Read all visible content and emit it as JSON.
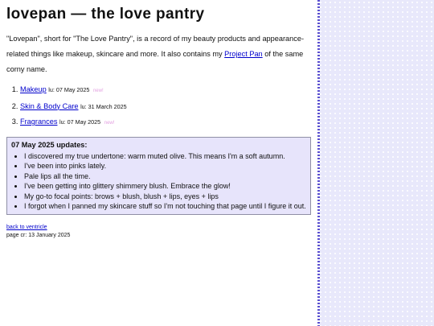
{
  "title": "lovepan — the love pantry",
  "intro": {
    "before_link": "\"Lovepan\", short for \"The Love Pantry\", is a record of my beauty products and appearance-related things like makeup, skincare and more. It also contains my ",
    "link": "Project Pan",
    "after_link": " of the same corny name."
  },
  "nav": [
    {
      "label": "Makeup",
      "lu": "lu: 07 May 2025",
      "badge": "new!"
    },
    {
      "label": "Skin & Body Care",
      "lu": "lu: 31 March 2025",
      "badge": ""
    },
    {
      "label": "Fragrances",
      "lu": "lu: 07 May 2025",
      "badge": "new!"
    }
  ],
  "updates": {
    "heading": "07 May 2025 updates:",
    "items": [
      "I discovered my true undertone: warm muted olive. This means I'm a soft autumn.",
      "I've been into pinks lately.",
      "Pale lips all the time.",
      "I've been getting into glittery shimmery blush. Embrace the glow!",
      "My go-to focal points: brows + blush, blush + lips, eyes + lips",
      "I forgot when I panned my skincare stuff so I'm not touching that page until I figure it out."
    ]
  },
  "footer": {
    "back_link": "back to ventricle",
    "created": "page cr: 13 January 2025"
  },
  "colors": {
    "link": "#0000cc",
    "new_badge": "#e3a0e0",
    "updates_bg": "#e7e4fb",
    "edge": "#5a4fd0",
    "pattern_bg": "#e8e8fb"
  }
}
